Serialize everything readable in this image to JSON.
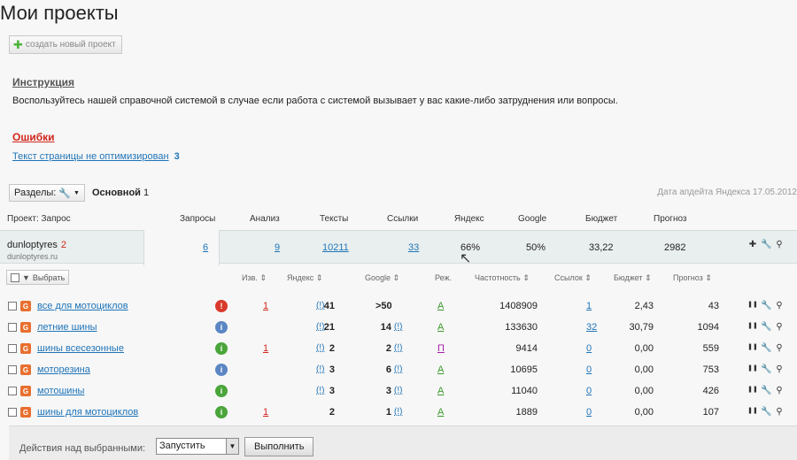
{
  "page": {
    "title": "Мои проекты",
    "new_project": "создать новый проект"
  },
  "instruction": {
    "title": "Инструкция",
    "text": "Воспользуйтесь нашей справочной системой в случае если работа с системой вызывает у вас какие-либо затруднения или вопросы."
  },
  "errors": {
    "title": "Ошибки",
    "link": "Текст страницы не оптимизирован",
    "count": "3"
  },
  "sections": {
    "button": "Разделы:",
    "current": "Основной",
    "current_count": "1",
    "update": "Дата апдейта Яндекса 17.05.2012"
  },
  "project_columns": {
    "project": "Проект: Запрос",
    "queries": "Запросы",
    "analysis": "Анализ",
    "texts": "Тексты",
    "links": "Ссылки",
    "yandex": "Яндекс",
    "google": "Google",
    "budget": "Бюджет",
    "forecast": "Прогноз"
  },
  "project": {
    "name": "dunloptyres",
    "count": "2",
    "domain": "dunloptyres.ru",
    "queries": "6",
    "analysis": "9",
    "texts": "10211",
    "links": "33",
    "yandex": "66%",
    "google": "50%",
    "budget": "33,22",
    "forecast": "2982"
  },
  "select_btn": "Выбрать",
  "kw_columns": {
    "izv": "Изв. ⇕",
    "yandex": "Яндекс ⇕",
    "google": "Google ⇕",
    "mode": "Реж.",
    "freq": "Частотность ⇕",
    "links": "Ссылок ⇕",
    "budget": "Бюджет ⇕",
    "forecast": "Прогноз ⇕"
  },
  "keywords": [
    {
      "text": "все для мотоциклов",
      "status": "!",
      "status_color": "#d93a2b",
      "izv": "1",
      "yandex": "41",
      "yandex_delta": "(!)",
      "google": ">50",
      "google_delta": "",
      "mode": "А",
      "freq": "1408909",
      "links": "1",
      "budget": "2,43",
      "forecast": "43"
    },
    {
      "text": "летние шины",
      "status": "i",
      "status_color": "#5b86c4",
      "izv": "",
      "yandex": "21",
      "yandex_delta": "(!)",
      "google": "14",
      "google_delta": "(!)",
      "mode": "А",
      "freq": "133630",
      "links": "32",
      "budget": "30,79",
      "forecast": "1094"
    },
    {
      "text": "шины всесезонные",
      "status": "i",
      "status_color": "#4aa53a",
      "izv": "1",
      "yandex": "2",
      "yandex_delta": "(!)",
      "google": "2",
      "google_delta": "(!)",
      "mode": "П",
      "freq": "9414",
      "links": "0",
      "budget": "0,00",
      "forecast": "559"
    },
    {
      "text": "моторезина",
      "status": "i",
      "status_color": "#5b86c4",
      "izv": "",
      "yandex": "3",
      "yandex_delta": "(!)",
      "google": "6",
      "google_delta": "(!)",
      "mode": "А",
      "freq": "10695",
      "links": "0",
      "budget": "0,00",
      "forecast": "753"
    },
    {
      "text": "мотошины",
      "status": "i",
      "status_color": "#4aa53a",
      "izv": "",
      "yandex": "3",
      "yandex_delta": "(!)",
      "google": "3",
      "google_delta": "(!)",
      "mode": "А",
      "freq": "11040",
      "links": "0",
      "budget": "0,00",
      "forecast": "426"
    },
    {
      "text": "шины для мотоциклов",
      "status": "i",
      "status_color": "#4aa53a",
      "izv": "1",
      "yandex": "2",
      "yandex_delta": "",
      "google": "1",
      "google_delta": "(!)",
      "mode": "А",
      "freq": "1889",
      "links": "0",
      "budget": "0,00",
      "forecast": "107"
    }
  ],
  "footer": {
    "label": "Действия над выбранными:",
    "select_value": "Запустить",
    "run": "Выполнить"
  }
}
